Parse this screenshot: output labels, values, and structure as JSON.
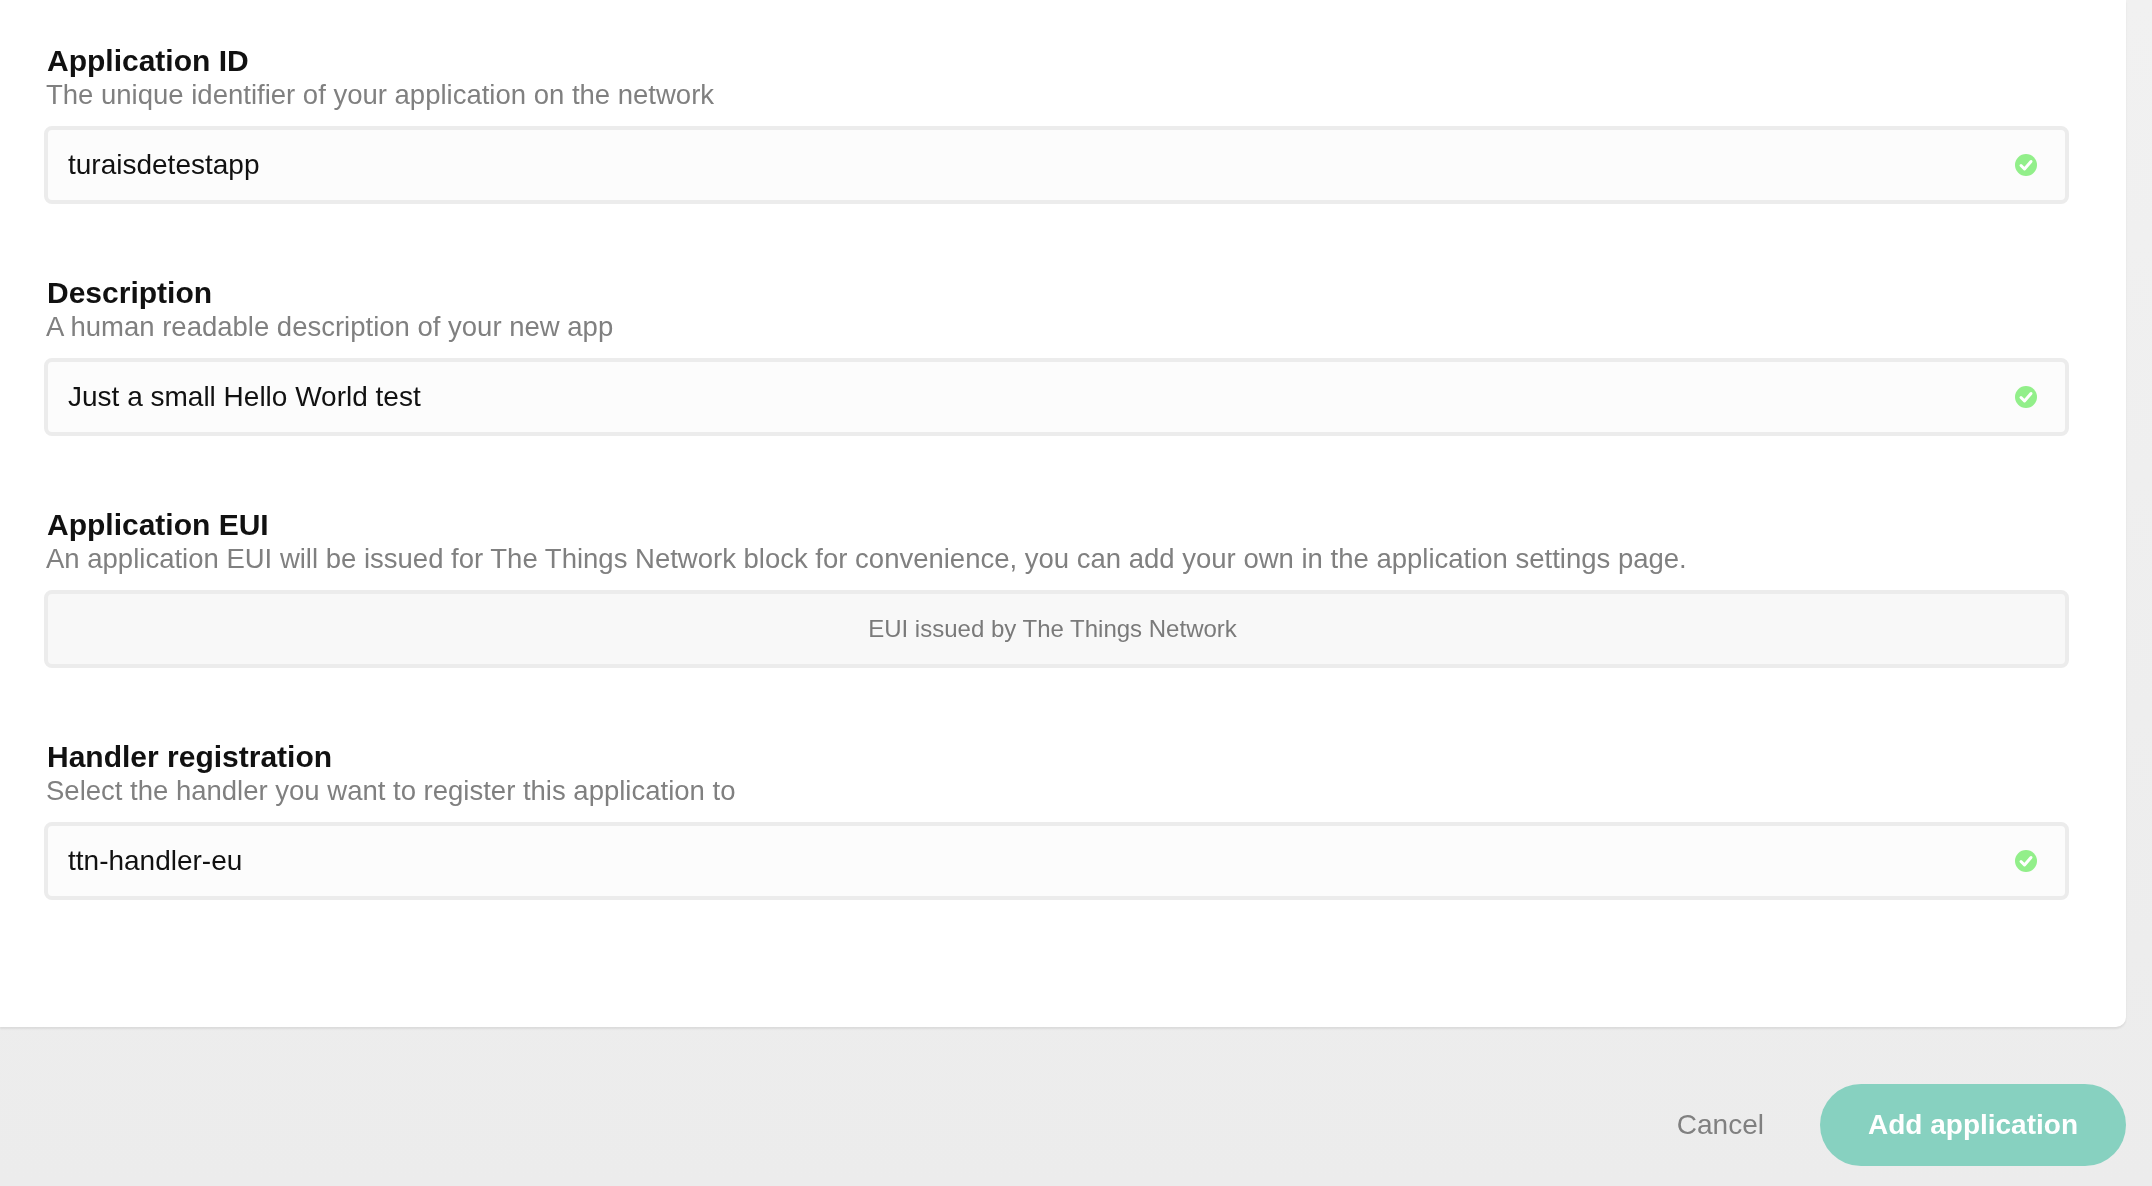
{
  "sections": [
    {
      "title": "Application ID",
      "description": "The unique identifier of your application on the network",
      "field": {
        "value": "turaisdetestapp",
        "valid": true
      }
    },
    {
      "title": "Description",
      "description": "A human readable description of your new app",
      "field": {
        "value": "Just a small Hello World test",
        "valid": true
      }
    },
    {
      "title": "Application EUI",
      "description": "An application EUI will be issued for The Things Network block for convenience, you can add your own in the application settings page.",
      "field": {
        "placeholder": "EUI issued by The Things Network",
        "valid": false
      }
    },
    {
      "title": "Handler registration",
      "description": "Select the handler you want to register this application to",
      "field": {
        "value": "ttn-handler-eu",
        "valid": true
      }
    }
  ],
  "footer": {
    "cancel": "Cancel",
    "submit": "Add application"
  }
}
